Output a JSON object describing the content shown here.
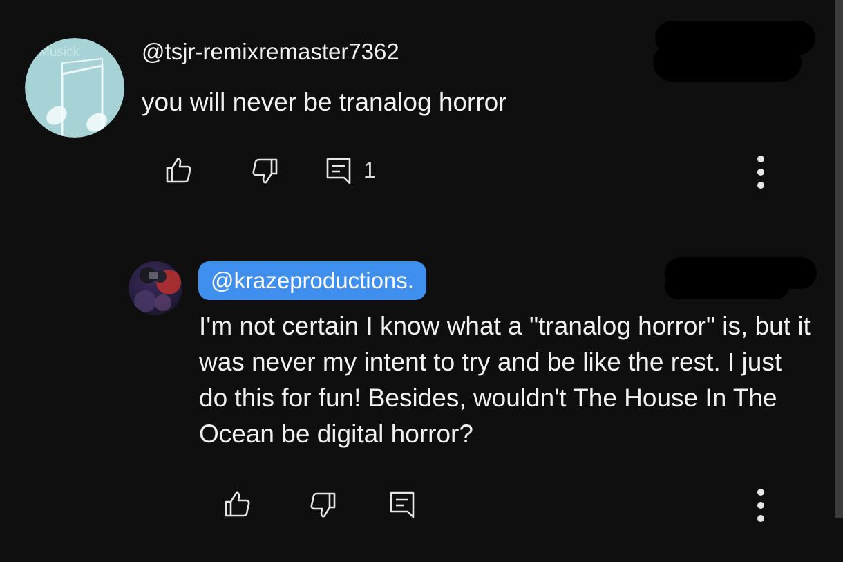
{
  "comment": {
    "author": "@tsjr-remixremaster7362",
    "avatar_icon": "music-note-icon",
    "avatar_text": "Musick",
    "text": "you will never be tranalog horror",
    "reply_count": "1"
  },
  "reply": {
    "author": "@krazeproductions.",
    "avatar_icon": "creature-avatar-icon",
    "text": "I'm not certain I know what a \"tranalog horror\" is, but it was never my intent to try and be like the rest. I just do this for fun! Besides, wouldn't The House In The Ocean be digital horror?"
  },
  "icons": {
    "like": "thumbs-up-icon",
    "dislike": "thumbs-down-icon",
    "replies": "comment-icon",
    "more": "more-vert-icon"
  },
  "colors": {
    "background": "#0f0f0f",
    "text": "#f1f1f1",
    "mention_pill": "#3e8fee",
    "avatar_teal": "#a8d3d6"
  }
}
